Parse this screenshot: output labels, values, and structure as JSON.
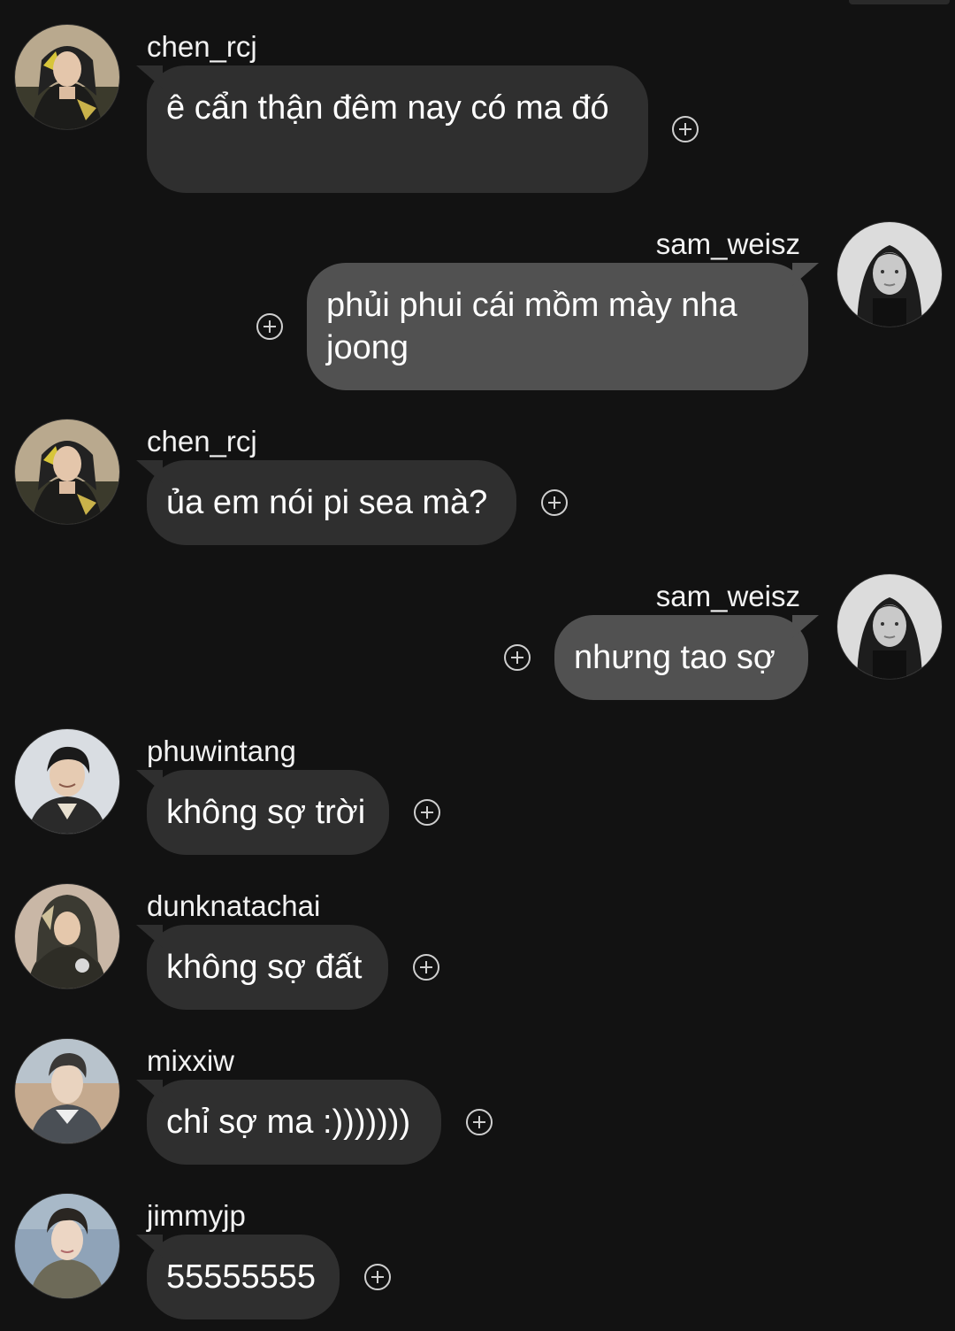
{
  "chat": {
    "messages": [
      {
        "sender": "chen_rcj",
        "text": "ê cẩn thận đêm nay có ma đó",
        "avatar_icon": "chen-rcj-avatar"
      },
      {
        "sender": "sam_weisz",
        "text": "phủi phui cái mồm mày nha joong",
        "avatar_icon": "sam-weisz-avatar"
      },
      {
        "sender": "chen_rcj",
        "text": "ủa em nói pi sea mà?",
        "avatar_icon": "chen-rcj-avatar"
      },
      {
        "sender": "sam_weisz",
        "text": "nhưng tao sợ",
        "avatar_icon": "sam-weisz-avatar"
      },
      {
        "sender": "phuwintang",
        "text": "không sợ trời",
        "avatar_icon": "phuwintang-avatar"
      },
      {
        "sender": "dunknatachai",
        "text": "không sợ đất",
        "avatar_icon": "dunknatachai-avatar"
      },
      {
        "sender": "mixxiw",
        "text": "chỉ sợ ma :)))))))",
        "avatar_icon": "mixxiw-avatar"
      },
      {
        "sender": "jimmyjp",
        "text": "55555555",
        "avatar_icon": "jimmyjp-avatar"
      }
    ],
    "reaction_icon": "add-reaction-icon"
  },
  "colors": {
    "background": "#121212",
    "incoming_bubble": "#2f2f2f",
    "outgoing_bubble": "#515151",
    "text": "#ffffff"
  }
}
